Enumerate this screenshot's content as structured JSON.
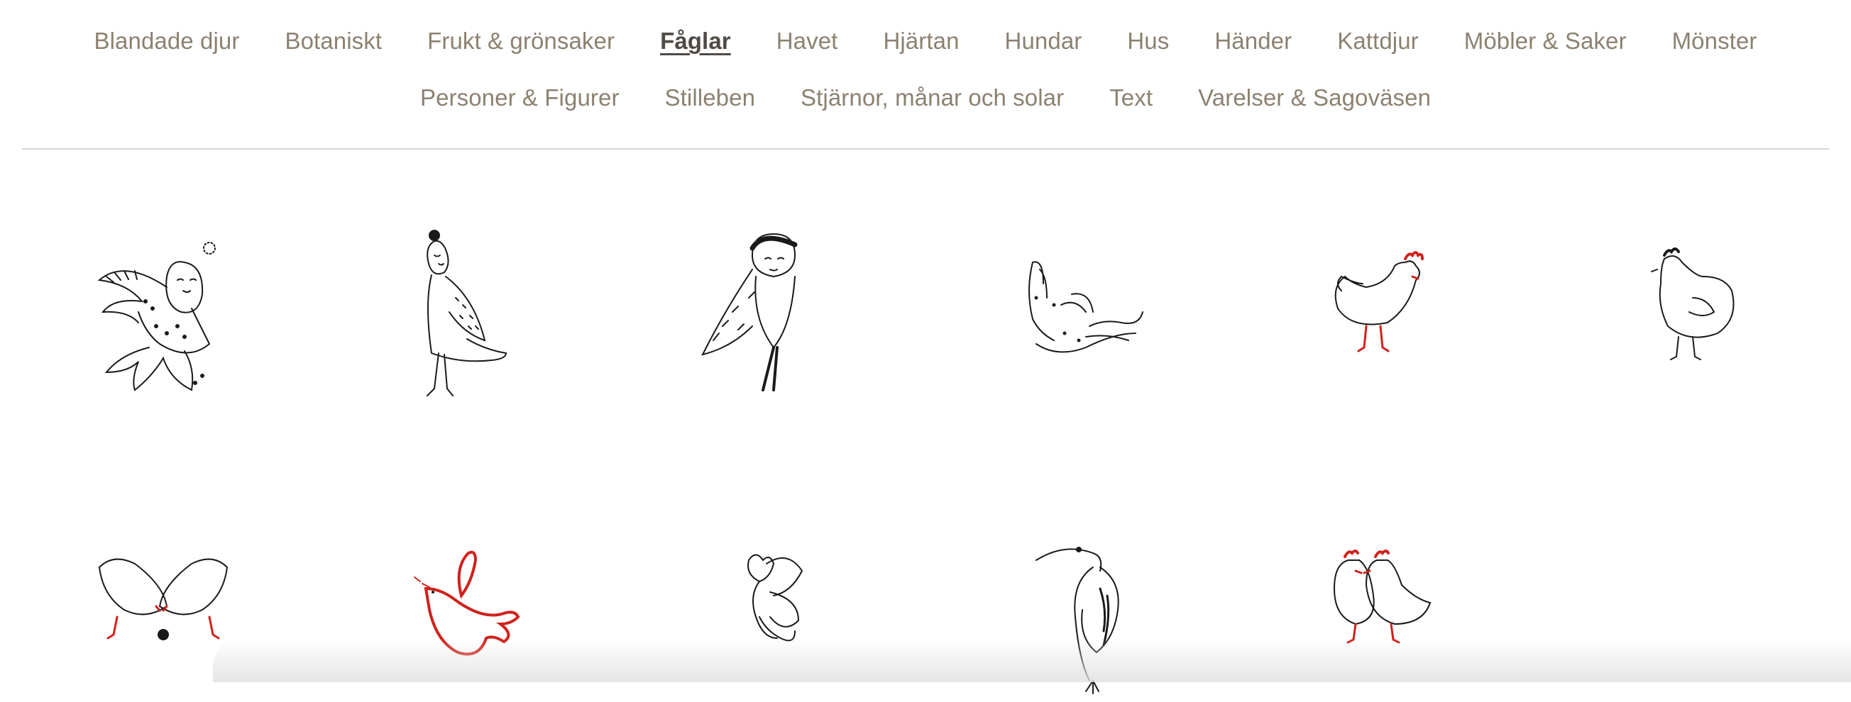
{
  "categories": {
    "row1": [
      {
        "label": "Blandade djur"
      },
      {
        "label": "Botaniskt"
      },
      {
        "label": "Frukt & grönsaker"
      },
      {
        "label": "Fåglar",
        "active": true
      },
      {
        "label": "Havet"
      },
      {
        "label": "Hjärtan"
      },
      {
        "label": "Hundar"
      },
      {
        "label": "Hus"
      },
      {
        "label": "Händer"
      },
      {
        "label": "Kattdjur"
      },
      {
        "label": "Möbler & Saker"
      },
      {
        "label": "Mönster"
      }
    ],
    "row2": [
      {
        "label": "Personer & Figurer"
      },
      {
        "label": "Stilleben"
      },
      {
        "label": "Stjärnor, månar och solar"
      },
      {
        "label": "Text"
      },
      {
        "label": "Varelser & Sagoväsen"
      }
    ]
  },
  "colors": {
    "nav_text": "#8c8170",
    "nav_active": "#4f4a46",
    "ink": "#1a1a1a",
    "accent_red": "#d0211c"
  },
  "products": [
    {
      "icon": "bird-woman-flying-dotted-icon"
    },
    {
      "icon": "bird-woman-standing-icon"
    },
    {
      "icon": "owl-woman-icon"
    },
    {
      "icon": "swallow-diving-icon"
    },
    {
      "icon": "hen-red-comb-icon"
    },
    {
      "icon": "hen-black-icon"
    },
    {
      "icon": "two-hens-pecking-icon"
    },
    {
      "icon": "red-dove-icon"
    },
    {
      "icon": "heart-bird-icon"
    },
    {
      "icon": "heron-icon"
    },
    {
      "icon": "two-hens-kissing-icon"
    }
  ]
}
